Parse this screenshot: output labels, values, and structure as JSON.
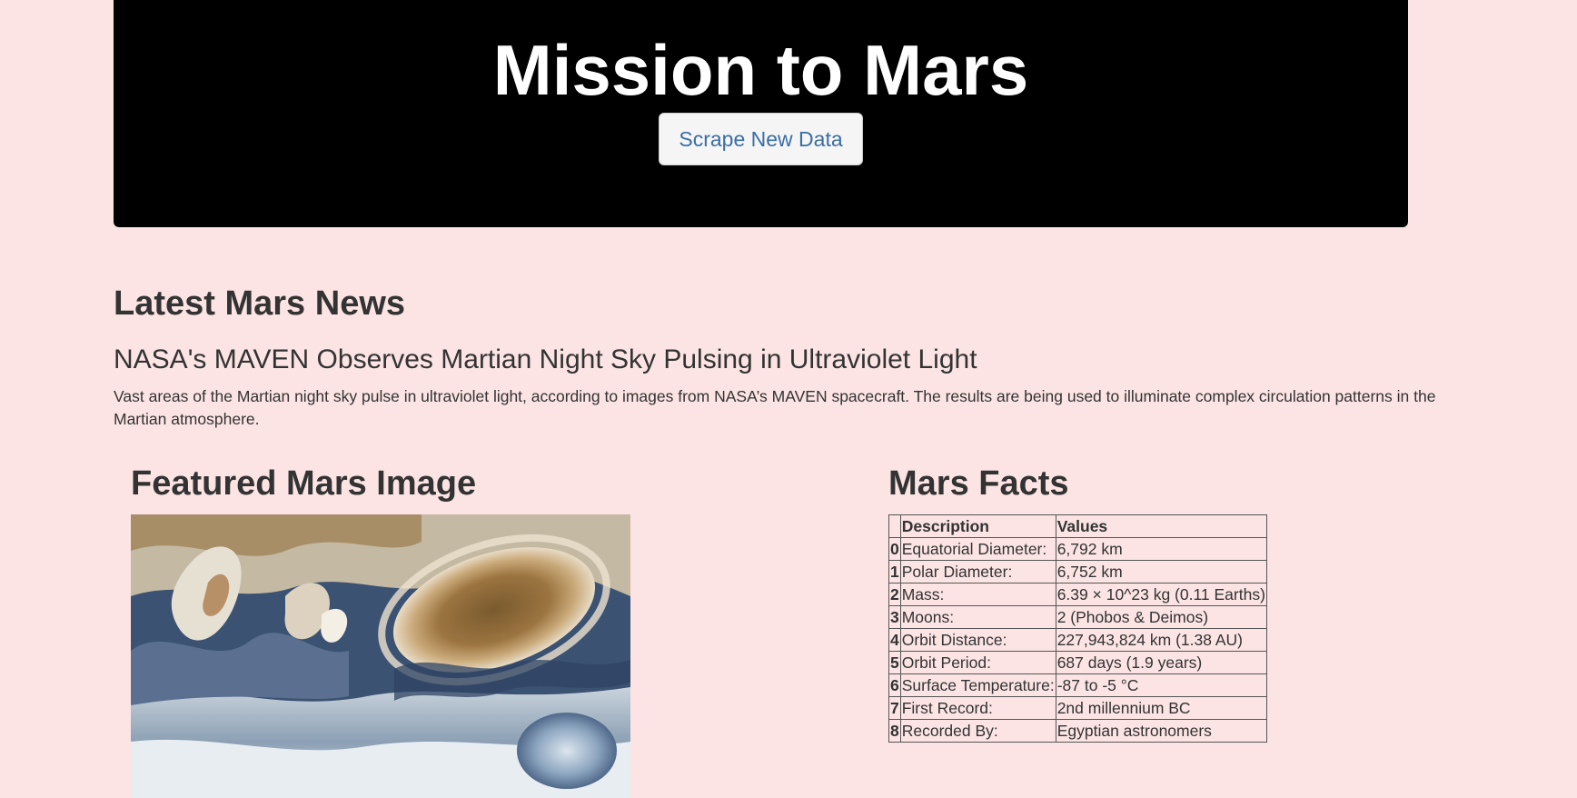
{
  "header": {
    "title": "Mission to Mars",
    "scrape_label": "Scrape New Data"
  },
  "news": {
    "heading": "Latest Mars News",
    "title": "NASA's MAVEN Observes Martian Night Sky Pulsing in Ultraviolet Light",
    "paragraph": "Vast areas of the Martian night sky pulse in ultraviolet light, according to images from NASA’s MAVEN spacecraft. The results are being used to illuminate complex circulation patterns in the Martian atmosphere."
  },
  "featured": {
    "heading": "Featured Mars Image"
  },
  "facts": {
    "heading": "Mars Facts",
    "columns": [
      "",
      "Description",
      "Values"
    ],
    "rows": [
      {
        "index": "0",
        "description": "Equatorial Diameter:",
        "value": "6,792 km"
      },
      {
        "index": "1",
        "description": "Polar Diameter:",
        "value": "6,752 km"
      },
      {
        "index": "2",
        "description": "Mass:",
        "value": "6.39 × 10^23 kg (0.11 Earths)"
      },
      {
        "index": "3",
        "description": "Moons:",
        "value": "2 (Phobos & Deimos)"
      },
      {
        "index": "4",
        "description": "Orbit Distance:",
        "value": "227,943,824 km (1.38 AU)"
      },
      {
        "index": "5",
        "description": "Orbit Period:",
        "value": "687 days (1.9 years)"
      },
      {
        "index": "6",
        "description": "Surface Temperature:",
        "value": "-87 to -5 °C"
      },
      {
        "index": "7",
        "description": "First Record:",
        "value": "2nd millennium BC"
      },
      {
        "index": "8",
        "description": "Recorded By:",
        "value": "Egyptian astronomers"
      }
    ]
  },
  "colors": {
    "background": "#fce4e4",
    "jumbotron": "#000000",
    "button_text": "#3a6ea5",
    "text": "#333333"
  }
}
